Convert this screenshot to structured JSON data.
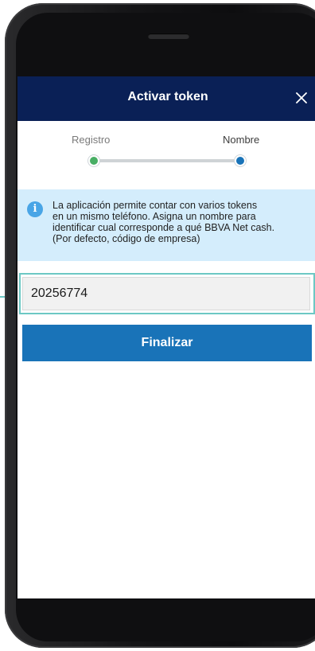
{
  "header": {
    "title": "Activar token",
    "close_icon": "close-icon"
  },
  "stepper": {
    "steps": [
      {
        "label": "Registro",
        "status": "done"
      },
      {
        "label": "Nombre",
        "status": "current"
      }
    ],
    "done_color": "#48ae64",
    "current_color": "#1973b8"
  },
  "info": {
    "icon": "info-icon",
    "icon_glyph": "i",
    "lines": [
      "La aplicación permite contar con varios tokens",
      "en un mismo teléfono. Asigna un nombre para",
      "identificar cual corresponde a qué BBVA Net cash.",
      "(Por defecto, código de empresa)"
    ]
  },
  "form": {
    "name_value": "20256774"
  },
  "actions": {
    "finish_label": "Finalizar"
  },
  "colors": {
    "header_bg": "#0a2056",
    "info_bg": "#d4edfc",
    "button_bg": "#1973b8",
    "highlight": "#6cc8c4"
  }
}
